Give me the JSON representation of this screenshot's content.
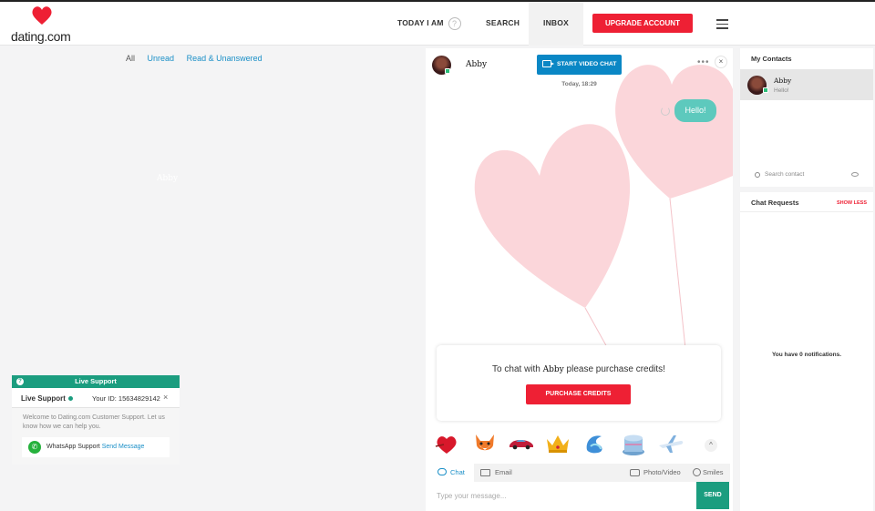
{
  "header": {
    "logo_text": "dating.com",
    "nav": {
      "today": "TODAY I AM",
      "help": "?",
      "search": "SEARCH",
      "inbox": "INBOX"
    },
    "upgrade_label": "UPGRADE ACCOUNT"
  },
  "inbox": {
    "filters": [
      "All",
      "Unread",
      "Read & Unanswered"
    ],
    "ghost_name": "Abby"
  },
  "support": {
    "title": "Live Support",
    "bar_label": "Live Support",
    "user_id": "Your ID: 15634829142",
    "close": "×",
    "message": "Welcome to Dating.com Customer Support. Let us know how we can help you.",
    "whatsapp_label": "WhatsApp Support",
    "whatsapp_link": "Send Message"
  },
  "chat": {
    "contact_name": "Abby",
    "video_button": "START VIDEO CHAT",
    "more": "•••",
    "close": "×",
    "date": "Today, 18:29",
    "messages": [
      {
        "from": "me",
        "text": "Hello!"
      }
    ],
    "credits_prefix": "To chat with",
    "credits_name": "Abby",
    "credits_suffix": "please purchase credits!",
    "purchase_button": "PURCHASE CREDITS",
    "gifts": [
      "heart-gift-icon",
      "fox-gift-icon",
      "car-gift-icon",
      "crown-gift-icon",
      "dragon-gift-icon",
      "cake-gift-icon",
      "plane-gift-icon"
    ],
    "gifts_toggle": "^",
    "tabs": {
      "chat": "Chat",
      "email": "Email",
      "photo": "Photo/Video",
      "smiles": "Smiles"
    },
    "input_placeholder": "Type your message...",
    "send_button": "SEND"
  },
  "contacts": {
    "title": "My Contacts",
    "items": [
      {
        "name": "Abby",
        "last_message": "Hello!"
      }
    ],
    "search_placeholder": "Search contact"
  },
  "requests": {
    "title": "Chat Requests",
    "toggle": "SHOW LESS",
    "empty": "You have 0 notifications."
  },
  "colors": {
    "brand_red": "#ee2034",
    "teal": "#1b9d7f",
    "link_blue": "#1a8fc7",
    "bubble": "#5dc9bd",
    "video_blue": "#0a87c5"
  }
}
